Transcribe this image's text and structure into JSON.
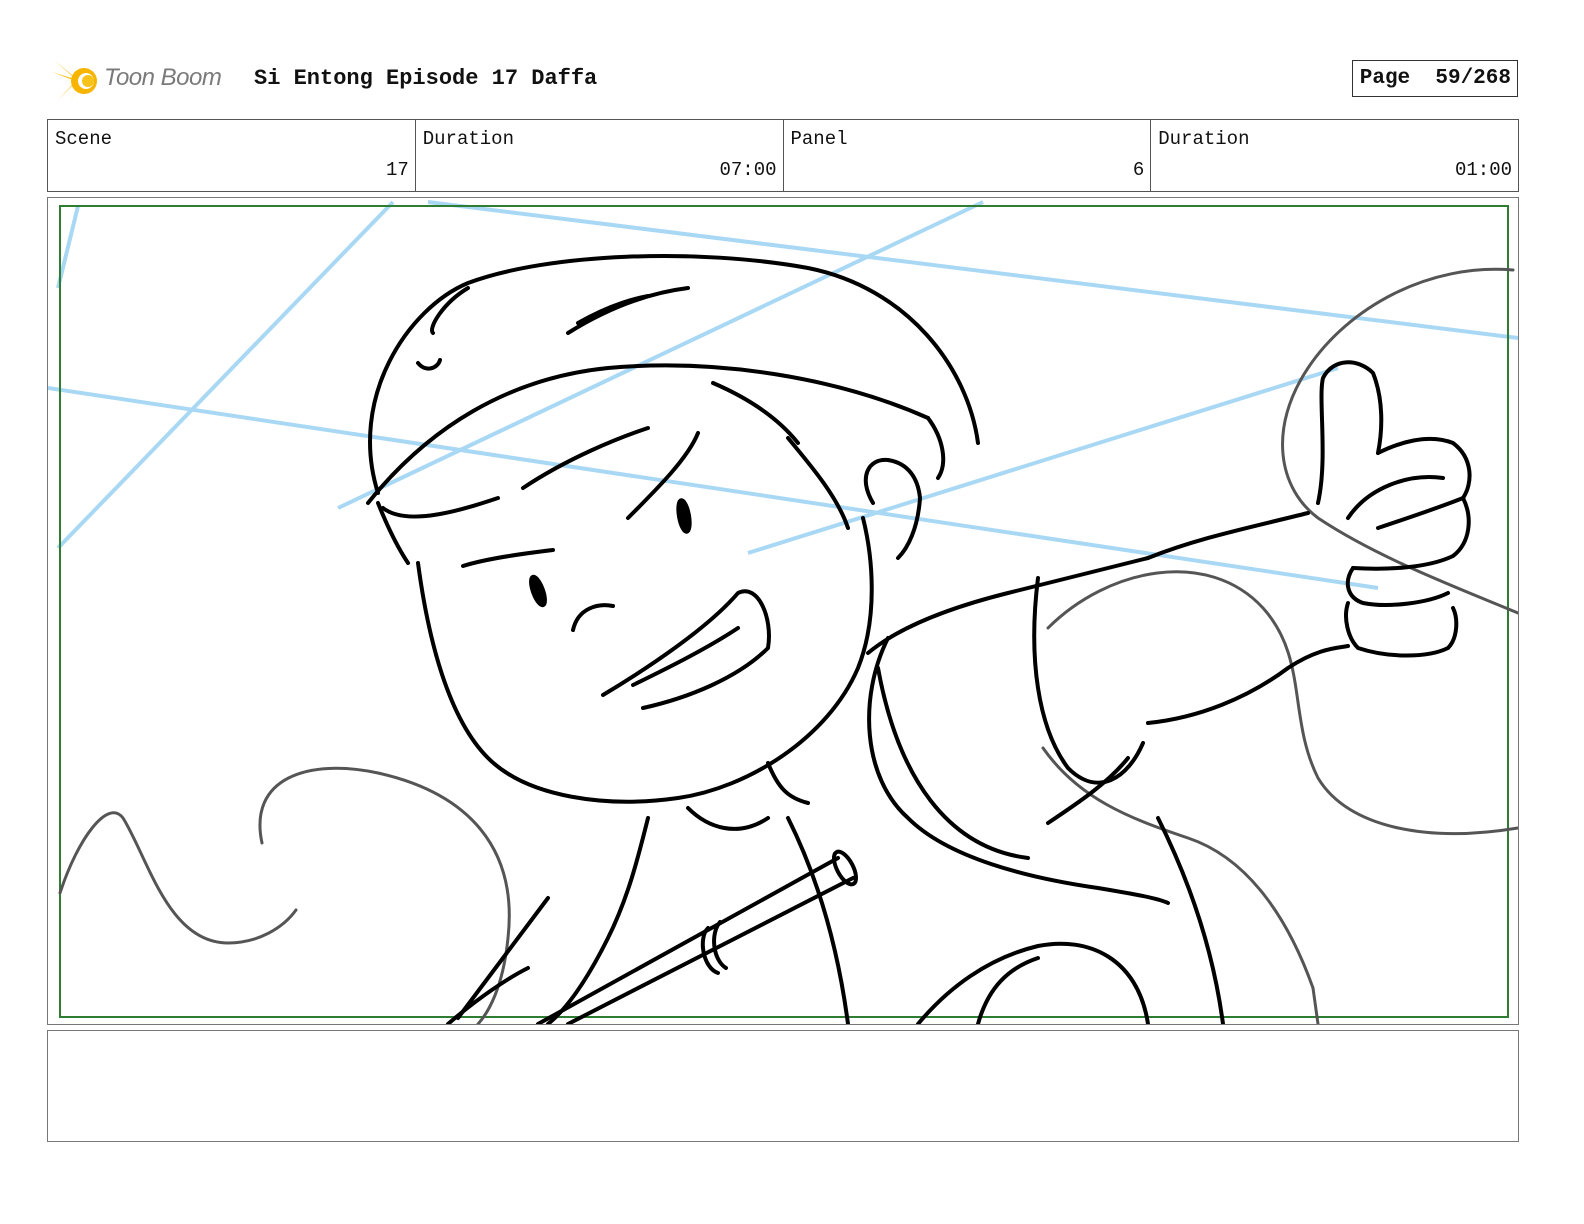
{
  "header": {
    "logo_text": "Toon Boom",
    "project_title": "Si Entong Episode 17 Daffa",
    "page_label": "Page",
    "page_value": "59/268"
  },
  "info": {
    "scene_label": "Scene",
    "scene_value": "17",
    "scene_duration_label": "Duration",
    "scene_duration_value": "07:00",
    "panel_label": "Panel",
    "panel_value": "6",
    "panel_duration_label": "Duration",
    "panel_duration_value": "01:00"
  },
  "notes": {
    "text": ""
  },
  "colors": {
    "safe_frame": "#2e7d32",
    "blue_guides": "#a9d8f5",
    "ink": "#000000",
    "rough_lines": "#555555",
    "logo_yellow": "#f7c21a"
  },
  "icons": {
    "logo": "toon-boom-burst-icon"
  }
}
